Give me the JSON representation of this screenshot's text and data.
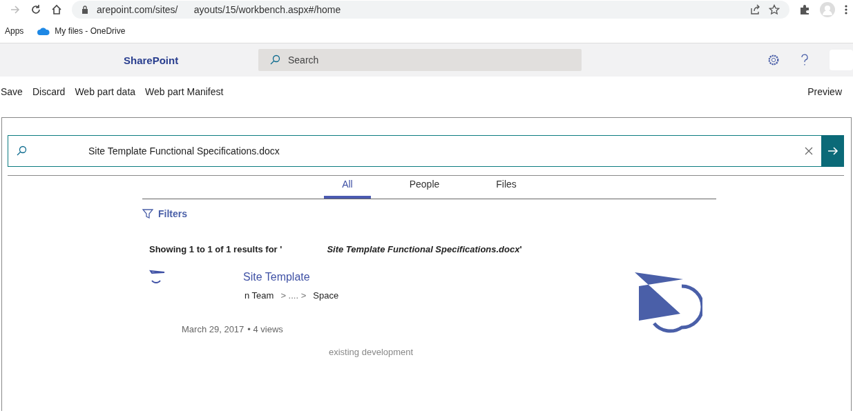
{
  "browser": {
    "url": "arepoint.com/sites/      ayouts/15/workbench.aspx#/home",
    "bookmarks": [
      "Apps",
      "My files - OneDrive"
    ]
  },
  "suite_bar": {
    "app_name": "SharePoint",
    "search": {
      "placeholder": "Search"
    }
  },
  "command_bar": {
    "left": [
      "Save",
      "Discard",
      "Web part data",
      "Web part Manifest"
    ],
    "right": "Preview"
  },
  "search_box": {
    "value": "Site Template Functional Specifications.docx"
  },
  "tabs": [
    {
      "label": "All",
      "selected": true
    },
    {
      "label": "People",
      "selected": false
    },
    {
      "label": "Files",
      "selected": false
    }
  ],
  "filters": "Filters",
  "summary": "Showing **1** to **1** of **1** results for '                  *Site Template Functional Specifications.docx*'",
  "result": {
    "title": "Site Template",
    "path": [
      "n Team",
      "> .... >",
      "Space"
    ],
    "date": "March 29, 2017",
    "views": "• 4 views",
    "snippet": "existing development"
  }
}
